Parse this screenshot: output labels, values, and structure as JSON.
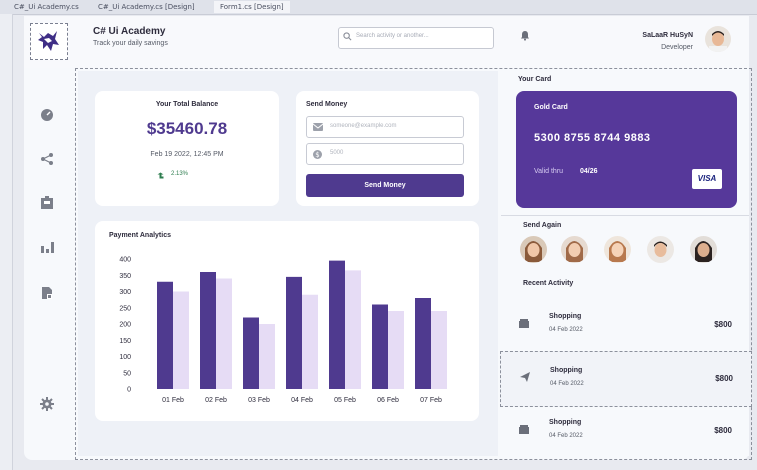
{
  "ide": {
    "tabs": [
      "C#_Ui Academy.cs",
      "C#_Ui Academy.cs [Design]",
      "Form1.cs [Design]"
    ]
  },
  "app": {
    "title": "C# Ui Academy",
    "subtitle": "Track your daily savings"
  },
  "search": {
    "placeholder": "Search activity or another..."
  },
  "user": {
    "name": "SaLaaR HuSyN",
    "role": "Developer"
  },
  "sidebar": {
    "icons": [
      "dashboard-gauge-icon",
      "share-icon",
      "id-card-icon",
      "bar-chart-icon",
      "document-icon",
      "settings-gear-icon"
    ]
  },
  "balance": {
    "title": "Your Total Balance",
    "amount": "$35460.78",
    "date": "Feb 19 2022, 12:45 PM",
    "growth": "2.13%"
  },
  "send_money": {
    "title": "Send Money",
    "email_placeholder": "someone@example.com",
    "amount_placeholder": "5000",
    "button": "Send Money"
  },
  "chart_data": {
    "type": "bar",
    "title": "Payment Analytics",
    "categories": [
      "01 Feb",
      "02 Feb",
      "03 Feb",
      "04 Feb",
      "05 Feb",
      "06 Feb",
      "07 Feb"
    ],
    "series": [
      {
        "values": [
          330,
          360,
          220,
          345,
          395,
          260,
          280
        ],
        "color": "#4f3a8f"
      },
      {
        "values": [
          300,
          340,
          200,
          290,
          365,
          240,
          240
        ],
        "color": "#e6dcf5"
      }
    ],
    "ylim": [
      0,
      400
    ],
    "yticks": [
      0,
      50,
      100,
      150,
      200,
      250,
      300,
      350,
      400
    ],
    "ytick_labels": [
      "0",
      "50",
      "100",
      "150",
      "200",
      "250",
      "300",
      "350",
      "400"
    ],
    "grid": false
  },
  "card": {
    "section_label": "Your Card",
    "name": "Gold Card",
    "number": "5300 8755 8744 9883",
    "valid_label": "Valid thru",
    "valid_value": "04/26",
    "brand": "VISA",
    "color": "#56389a"
  },
  "send_again": {
    "label": "Send Again"
  },
  "recent": {
    "label": "Recent Activity",
    "items": [
      {
        "title": "Shopping",
        "date": "04 Feb 2022",
        "amount": "$800",
        "icon": "shopping-bag-icon"
      },
      {
        "title": "Shopping",
        "date": "04 Feb 2022",
        "amount": "$800",
        "icon": "send-plane-icon"
      },
      {
        "title": "Shopping",
        "date": "04 Feb 2022",
        "amount": "$800",
        "icon": "shopping-bag-icon"
      }
    ]
  }
}
